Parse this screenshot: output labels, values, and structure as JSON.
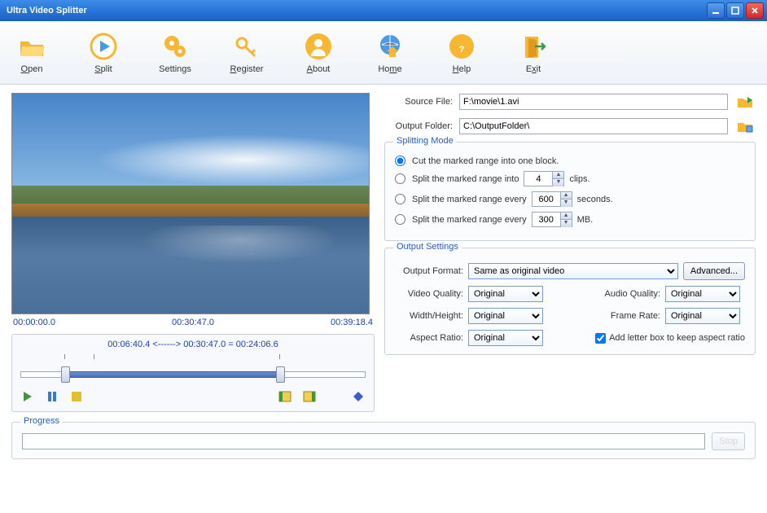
{
  "window": {
    "title": "Ultra Video Splitter"
  },
  "toolbar": {
    "open": "Open",
    "split": "Split",
    "settings": "Settings",
    "register": "Register",
    "about": "About",
    "home": "Home",
    "help": "Help",
    "exit": "Exit"
  },
  "times": {
    "start": "00:00:00.0",
    "current": "00:30:47.0",
    "end": "00:39:18.4"
  },
  "range": {
    "text": "00:06:40.4 <------> 00:30:47.0 = 00:24:06.6"
  },
  "source": {
    "label": "Source File:",
    "value": "F:\\movie\\1.avi"
  },
  "output_folder": {
    "label": "Output Folder:",
    "value": "C:\\OutputFolder\\"
  },
  "splitting": {
    "legend": "Splitting Mode",
    "opt1": "Cut the marked range into one block.",
    "opt2_pre": "Split the marked range into",
    "opt2_val": "4",
    "opt2_post": "clips.",
    "opt3_pre": "Split the marked range every",
    "opt3_val": "600",
    "opt3_post": "seconds.",
    "opt4_pre": "Split the marked range every",
    "opt4_val": "300",
    "opt4_post": "MB."
  },
  "outset": {
    "legend": "Output Settings",
    "format_label": "Output Format:",
    "format_value": "Same as original video",
    "advanced": "Advanced...",
    "vq_label": "Video Quality:",
    "vq_value": "Original",
    "aq_label": "Audio Quality:",
    "aq_value": "Original",
    "wh_label": "Width/Height:",
    "wh_value": "Original",
    "fr_label": "Frame Rate:",
    "fr_value": "Original",
    "ar_label": "Aspect Ratio:",
    "ar_value": "Original",
    "letterbox": "Add letter box to keep aspect ratio"
  },
  "progress": {
    "legend": "Progress",
    "stop": "Stop"
  }
}
